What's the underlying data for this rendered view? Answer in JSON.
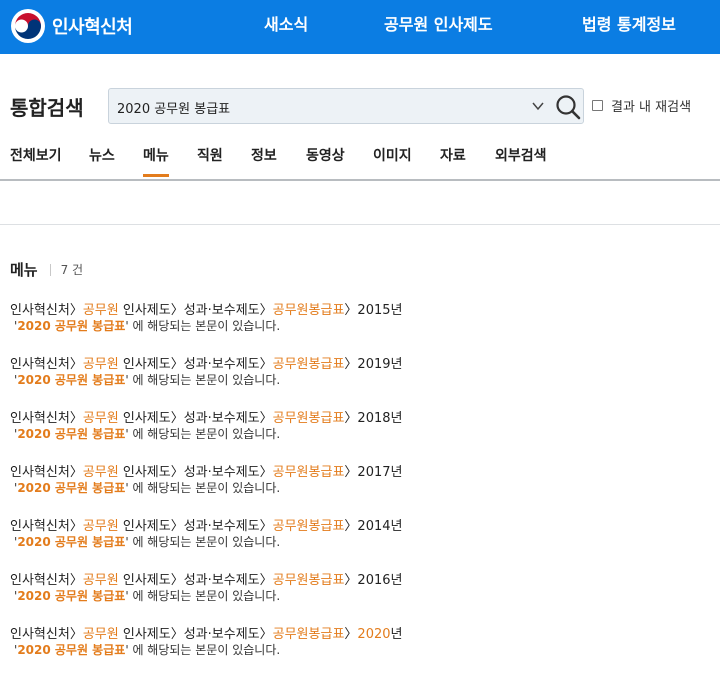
{
  "header": {
    "brand": "인사혁신처",
    "nav": [
      "새소식",
      "공무원 인사제도",
      "법령 통계정보"
    ],
    "color": "#0b7de3"
  },
  "search": {
    "title": "통합검색",
    "query": "2020 공무원 봉급표",
    "recheck_label": "결과 내 재검색"
  },
  "tabs": [
    "전체보기",
    "뉴스",
    "메뉴",
    "직원",
    "정보",
    "동영상",
    "이미지",
    "자료",
    "외부검색"
  ],
  "active_tab": "메뉴",
  "section": {
    "name": "메뉴",
    "count": "7 건"
  },
  "results": [
    {
      "p1": "인사혁신처",
      "p2": "공무원",
      "p3": "인사제도",
      "p4": "성과·보수제도",
      "p5": "공무원봉급표",
      "year": "2015년",
      "year_hl": false
    },
    {
      "p1": "인사혁신처",
      "p2": "공무원",
      "p3": "인사제도",
      "p4": "성과·보수제도",
      "p5": "공무원봉급표",
      "year": "2019년",
      "year_hl": false
    },
    {
      "p1": "인사혁신처",
      "p2": "공무원",
      "p3": "인사제도",
      "p4": "성과·보수제도",
      "p5": "공무원봉급표",
      "year": "2018년",
      "year_hl": false
    },
    {
      "p1": "인사혁신처",
      "p2": "공무원",
      "p3": "인사제도",
      "p4": "성과·보수제도",
      "p5": "공무원봉급표",
      "year": "2017년",
      "year_hl": false
    },
    {
      "p1": "인사혁신처",
      "p2": "공무원",
      "p3": "인사제도",
      "p4": "성과·보수제도",
      "p5": "공무원봉급표",
      "year": "2014년",
      "year_hl": false
    },
    {
      "p1": "인사혁신처",
      "p2": "공무원",
      "p3": "인사제도",
      "p4": "성과·보수제도",
      "p5": "공무원봉급표",
      "year": "2016년",
      "year_hl": false
    },
    {
      "p1": "인사혁신처",
      "p2": "공무원",
      "p3": "인사제도",
      "p4": "성과·보수제도",
      "p5": "공무원봉급표",
      "year": "2020",
      "year_suffix": "년",
      "year_hl": true
    }
  ],
  "result_desc": {
    "query": "2020 공무원 봉급표",
    "suffix": "에 해당되는 본문이 있습니다."
  }
}
